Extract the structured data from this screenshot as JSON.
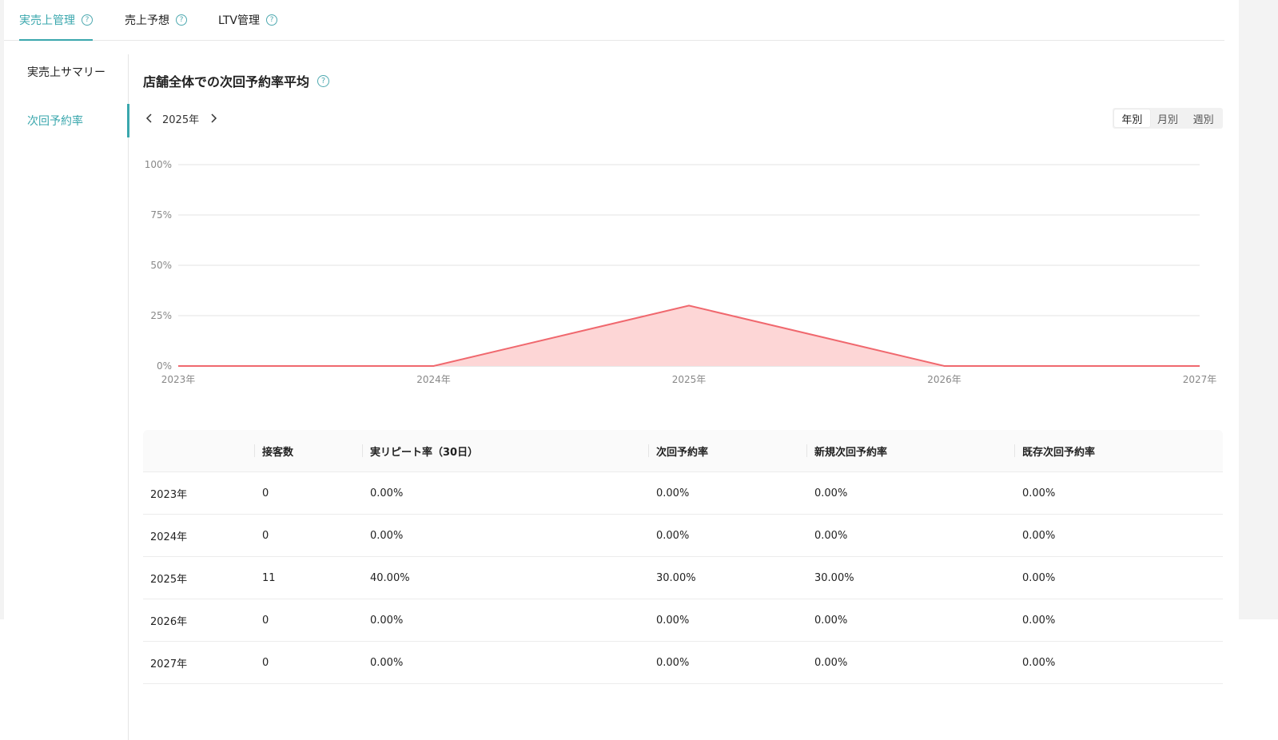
{
  "tabs": [
    {
      "label": "実売上管理",
      "active": true
    },
    {
      "label": "売上予想",
      "active": false
    },
    {
      "label": "LTV管理",
      "active": false
    }
  ],
  "sidebar": {
    "items": [
      {
        "label": "実売上サマリー",
        "active": false
      },
      {
        "label": "次回予約率",
        "active": true
      }
    ]
  },
  "main": {
    "title": "店舗全体での次回予約率平均",
    "year_nav": {
      "prev_icon": "chevron-left-icon",
      "label": "2025年",
      "next_icon": "chevron-right-icon"
    },
    "period_toggle": [
      "年別",
      "月別",
      "週別"
    ],
    "period_selected": "年別"
  },
  "colors": {
    "accent": "#3aa7ad",
    "line": "#f0686e",
    "area": "#fdd6d6",
    "grid": "#e3e3e3"
  },
  "chart_data": {
    "type": "area",
    "x": [
      "2023年",
      "2024年",
      "2025年",
      "2026年",
      "2027年"
    ],
    "y_ticks": [
      "0%",
      "25%",
      "50%",
      "75%",
      "100%"
    ],
    "ylim": [
      0,
      100
    ],
    "series": [
      {
        "values": [
          0,
          0,
          30,
          0,
          0
        ]
      }
    ],
    "grid": true
  },
  "table": {
    "headers": [
      "",
      "接客数",
      "実リピート率（30日）",
      "次回予約率",
      "新規次回予約率",
      "既存次回予約率"
    ],
    "rows": [
      [
        "2023年",
        "0",
        "0.00%",
        "0.00%",
        "0.00%",
        "0.00%"
      ],
      [
        "2024年",
        "0",
        "0.00%",
        "0.00%",
        "0.00%",
        "0.00%"
      ],
      [
        "2025年",
        "11",
        "40.00%",
        "30.00%",
        "30.00%",
        "0.00%"
      ],
      [
        "2026年",
        "0",
        "0.00%",
        "0.00%",
        "0.00%",
        "0.00%"
      ],
      [
        "2027年",
        "0",
        "0.00%",
        "0.00%",
        "0.00%",
        "0.00%"
      ]
    ]
  }
}
